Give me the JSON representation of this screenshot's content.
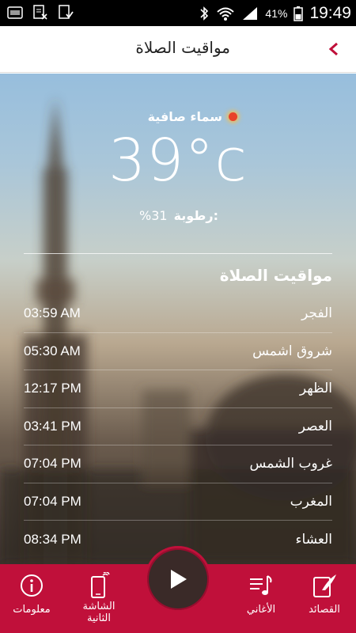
{
  "status_bar": {
    "battery": "41%",
    "time": "19:49"
  },
  "header": {
    "title": "مواقيت الصلاة",
    "back_icon": "chevron-left-icon"
  },
  "weather": {
    "condition": "سماء صافية",
    "temperature": "39°c",
    "humidity_label": "رطوبة:",
    "humidity_value": "%31"
  },
  "prayer": {
    "title": "مواقيت الصلاة",
    "times": [
      {
        "name": "الفجر",
        "time": "03:59 AM"
      },
      {
        "name": "شروق اشمس",
        "time": "05:30 AM"
      },
      {
        "name": "الظهر",
        "time": "12:17 PM"
      },
      {
        "name": "العصر",
        "time": "03:41 PM"
      },
      {
        "name": "غروب الشمس",
        "time": "07:04 PM"
      },
      {
        "name": "المغرب",
        "time": "07:04 PM"
      },
      {
        "name": "العشاء",
        "time": "08:34 PM"
      }
    ]
  },
  "bottom_nav": {
    "info": "معلومات",
    "second_screen": "الشاشة\nالثانية",
    "songs": "الأغاني",
    "poems": "القصائد",
    "play_icon": "play-icon"
  },
  "colors": {
    "accent": "#c0103a",
    "header_bg": "#ffffff"
  }
}
